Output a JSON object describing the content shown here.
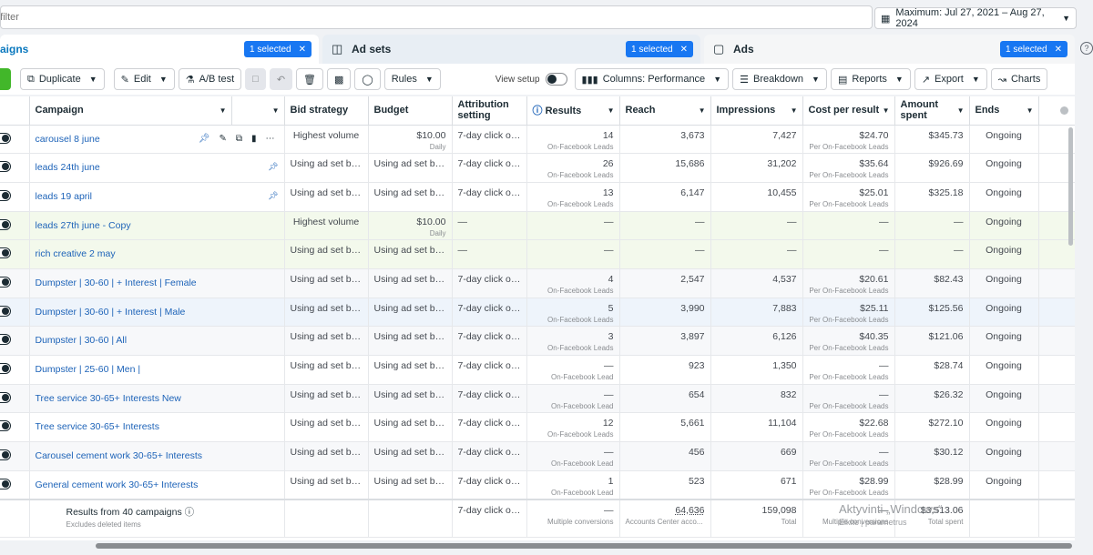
{
  "filter": {
    "placeholder": "d filter"
  },
  "date_range": {
    "label": "Maximum: Jul 27, 2021 – Aug 27, 2024"
  },
  "tabs": [
    {
      "label": "aigns",
      "badge": "1 selected"
    },
    {
      "label": "Ad sets",
      "badge": "1 selected"
    },
    {
      "label": "Ads",
      "badge": "1 selected"
    }
  ],
  "toolbar": {
    "duplicate": "Duplicate",
    "edit": "Edit",
    "ab_test": "A/B test",
    "rules": "Rules",
    "view_setup": "View setup",
    "columns": "Columns: Performance",
    "breakdown": "Breakdown",
    "reports": "Reports",
    "export": "Export",
    "charts": "Charts"
  },
  "columns": {
    "campaign": "Campaign",
    "bid_strategy": "Bid strategy",
    "budget": "Budget",
    "attribution": "Attribution setting",
    "results": "Results",
    "reach": "Reach",
    "impressions": "Impressions",
    "cost_per_result": "Cost per result",
    "amount_spent": "Amount spent",
    "ends": "Ends"
  },
  "rows": [
    {
      "name": "carousel 8 june",
      "bid": "Highest volume",
      "budget": "$10.00",
      "budget_sub": "Daily",
      "attr": "7-day click or ...",
      "results": "14",
      "results_sub": "On-Facebook Leads",
      "reach": "3,673",
      "impr": "7,427",
      "cpr": "$24.70",
      "cpr_sub": "Per On-Facebook Leads",
      "spent": "$345.73",
      "ends": "Ongoing"
    },
    {
      "name": "leads 24th june",
      "bid": "Using ad set bid ...",
      "budget": "Using ad set bud...",
      "budget_sub": "",
      "attr": "7-day click or ...",
      "results": "26",
      "results_sub": "On-Facebook Leads",
      "reach": "15,686",
      "impr": "31,202",
      "cpr": "$35.64",
      "cpr_sub": "Per On-Facebook Leads",
      "spent": "$926.69",
      "ends": "Ongoing"
    },
    {
      "name": "leads 19 april",
      "bid": "Using ad set bid ...",
      "budget": "Using ad set bud...",
      "budget_sub": "",
      "attr": "7-day click or ...",
      "results": "13",
      "results_sub": "On-Facebook Leads",
      "reach": "6,147",
      "impr": "10,455",
      "cpr": "$25.01",
      "cpr_sub": "Per On-Facebook Leads",
      "spent": "$325.18",
      "ends": "Ongoing"
    },
    {
      "name": "leads 27th june - Copy",
      "bid": "Highest volume",
      "budget": "$10.00",
      "budget_sub": "Daily",
      "attr": "—",
      "results": "—",
      "results_sub": "",
      "reach": "—",
      "impr": "—",
      "cpr": "—",
      "cpr_sub": "",
      "spent": "—",
      "ends": "Ongoing"
    },
    {
      "name": "rich creative 2 may",
      "bid": "Using ad set bid ...",
      "budget": "Using ad set bud...",
      "budget_sub": "",
      "attr": "—",
      "results": "—",
      "results_sub": "",
      "reach": "—",
      "impr": "—",
      "cpr": "—",
      "cpr_sub": "",
      "spent": "—",
      "ends": "Ongoing"
    },
    {
      "name": "Dumpster | 30-60 | + Interest | Female",
      "bid": "Using ad set bid ...",
      "budget": "Using ad set bud...",
      "budget_sub": "",
      "attr": "7-day click or ...",
      "results": "4",
      "results_sub": "On-Facebook Leads",
      "reach": "2,547",
      "impr": "4,537",
      "cpr": "$20.61",
      "cpr_sub": "Per On-Facebook Leads",
      "spent": "$82.43",
      "ends": "Ongoing"
    },
    {
      "name": "Dumpster | 30-60 | + Interest | Male",
      "bid": "Using ad set bid ...",
      "budget": "Using ad set bud...",
      "budget_sub": "",
      "attr": "7-day click or ...",
      "results": "5",
      "results_sub": "On-Facebook Leads",
      "reach": "3,990",
      "impr": "7,883",
      "cpr": "$25.11",
      "cpr_sub": "Per On-Facebook Leads",
      "spent": "$125.56",
      "ends": "Ongoing"
    },
    {
      "name": "Dumpster | 30-60 | All",
      "bid": "Using ad set bid ...",
      "budget": "Using ad set bud...",
      "budget_sub": "",
      "attr": "7-day click or ...",
      "results": "3",
      "results_sub": "On-Facebook Leads",
      "reach": "3,897",
      "impr": "6,126",
      "cpr": "$40.35",
      "cpr_sub": "Per On-Facebook Leads",
      "spent": "$121.06",
      "ends": "Ongoing"
    },
    {
      "name": "Dumpster | 25-60 | Men |",
      "bid": "Using ad set bid ...",
      "budget": "Using ad set bud...",
      "budget_sub": "",
      "attr": "7-day click or ...",
      "results": "—",
      "results_sub": "On-Facebook Lead",
      "reach": "923",
      "impr": "1,350",
      "cpr": "—",
      "cpr_sub": "Per On-Facebook Leads",
      "spent": "$28.74",
      "ends": "Ongoing"
    },
    {
      "name": "Tree service 30-65+ Interests New",
      "bid": "Using ad set bid ...",
      "budget": "Using ad set bud...",
      "budget_sub": "",
      "attr": "7-day click or ...",
      "results": "—",
      "results_sub": "On-Facebook Lead",
      "reach": "654",
      "impr": "832",
      "cpr": "—",
      "cpr_sub": "Per On-Facebook Leads",
      "spent": "$26.32",
      "ends": "Ongoing"
    },
    {
      "name": "Tree service 30-65+ Interests",
      "bid": "Using ad set bid ...",
      "budget": "Using ad set bud...",
      "budget_sub": "",
      "attr": "7-day click or ...",
      "results": "12",
      "results_sub": "On-Facebook Leads",
      "reach": "5,661",
      "impr": "11,104",
      "cpr": "$22.68",
      "cpr_sub": "Per On-Facebook Leads",
      "spent": "$272.10",
      "ends": "Ongoing"
    },
    {
      "name": "Carousel cement work 30-65+ Interests",
      "bid": "Using ad set bid ...",
      "budget": "Using ad set bud...",
      "budget_sub": "",
      "attr": "7-day click or ...",
      "results": "—",
      "results_sub": "On-Facebook Lead",
      "reach": "456",
      "impr": "669",
      "cpr": "—",
      "cpr_sub": "Per On-Facebook Leads",
      "spent": "$30.12",
      "ends": "Ongoing"
    },
    {
      "name": "General cement work 30-65+ Interests",
      "bid": "Using ad set bid ...",
      "budget": "Using ad set bud...",
      "budget_sub": "",
      "attr": "7-day click or ...",
      "results": "1",
      "results_sub": "On-Facebook Lead",
      "reach": "523",
      "impr": "671",
      "cpr": "$28.99",
      "cpr_sub": "Per On-Facebook Leads",
      "spent": "$28.99",
      "ends": "Ongoing"
    }
  ],
  "summary": {
    "label": "Results from 40 campaigns",
    "sub": "Excludes deleted items",
    "attr": "7-day click or ...",
    "results": "—",
    "results_sub": "Multiple conversions",
    "reach": "64,636",
    "reach_sub": "Accounts Center acco...",
    "impr": "159,098",
    "impr_sub": "Total",
    "cpr": "—",
    "cpr_sub": "Multiple conversions",
    "spent": "$3,513.06",
    "spent_sub": "Total spent"
  },
  "watermark": {
    "line1": "Aktyvinti „Windows“",
    "line2": "Eikite į parametrus"
  }
}
